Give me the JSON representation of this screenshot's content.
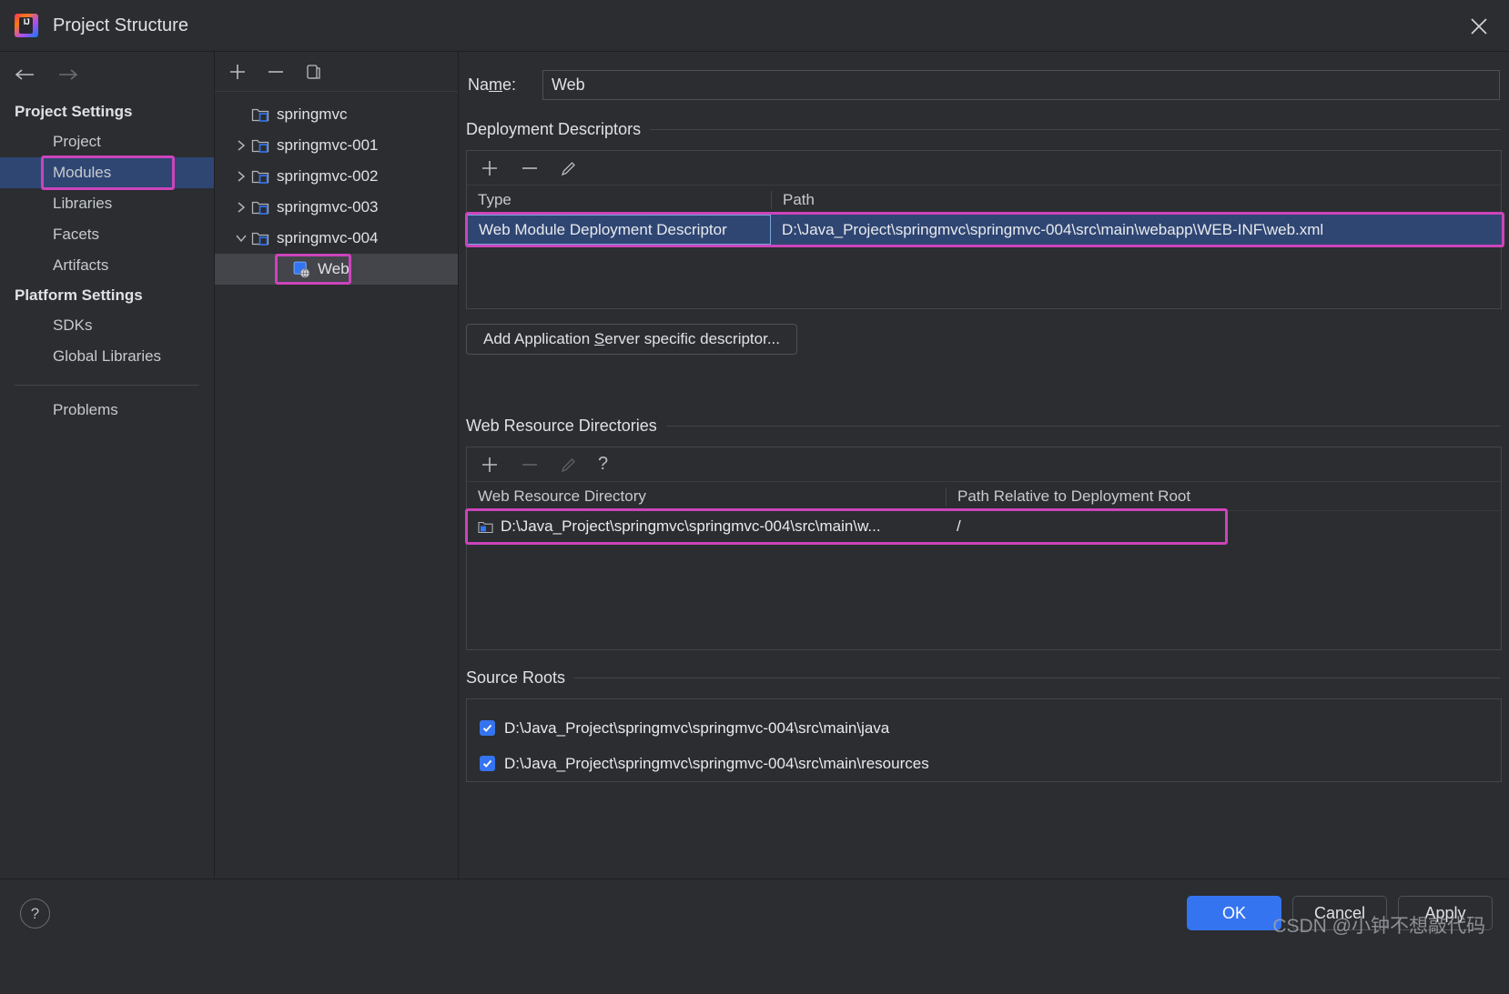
{
  "window": {
    "title": "Project Structure",
    "logo_text": "IJ",
    "close_icon": "close-icon"
  },
  "nav": {
    "back_icon": "arrow-left-icon",
    "forward_icon": "arrow-right-icon"
  },
  "sidebar": {
    "groups": [
      {
        "label": "Project Settings",
        "items": [
          {
            "label": "Project",
            "selected": false
          },
          {
            "label": "Modules",
            "selected": true,
            "annotated": true
          },
          {
            "label": "Libraries",
            "selected": false
          },
          {
            "label": "Facets",
            "selected": false
          },
          {
            "label": "Artifacts",
            "selected": false
          }
        ]
      },
      {
        "label": "Platform Settings",
        "items": [
          {
            "label": "SDKs",
            "selected": false
          },
          {
            "label": "Global Libraries",
            "selected": false
          }
        ]
      }
    ],
    "problems": {
      "label": "Problems"
    }
  },
  "tree": {
    "toolbar": [
      {
        "name": "add-module-button",
        "icon": "plus-icon"
      },
      {
        "name": "remove-module-button",
        "icon": "minus-icon"
      },
      {
        "name": "copy-module-button",
        "icon": "copy-icon"
      }
    ],
    "rows": [
      {
        "label": "springmvc",
        "icon": "module-icon",
        "chevron": "none",
        "indent": 0,
        "selected": false
      },
      {
        "label": "springmvc-001",
        "icon": "module-icon",
        "chevron": "collapsed",
        "indent": 0,
        "selected": false
      },
      {
        "label": "springmvc-002",
        "icon": "module-icon",
        "chevron": "collapsed",
        "indent": 0,
        "selected": false
      },
      {
        "label": "springmvc-003",
        "icon": "module-icon",
        "chevron": "collapsed",
        "indent": 0,
        "selected": false
      },
      {
        "label": "springmvc-004",
        "icon": "module-icon",
        "chevron": "expanded",
        "indent": 0,
        "selected": false
      },
      {
        "label": "Web",
        "icon": "web-facet-icon",
        "chevron": "none",
        "indent": 1,
        "selected": true,
        "annotated": true
      }
    ]
  },
  "main": {
    "name_field": {
      "label_pre": "Na",
      "label_mnemonic": "m",
      "label_post": "e:",
      "value": "Web"
    },
    "deployment_descriptors": {
      "title": "Deployment Descriptors",
      "toolbar": [
        {
          "name": "add-descriptor-button",
          "icon": "plus-icon",
          "enabled": true
        },
        {
          "name": "remove-descriptor-button",
          "icon": "minus-icon",
          "enabled": true
        },
        {
          "name": "edit-descriptor-button",
          "icon": "pencil-icon",
          "enabled": true
        }
      ],
      "columns": [
        "Type",
        "Path"
      ],
      "rows": [
        {
          "type": "Web Module Deployment Descriptor",
          "path": "D:\\Java_Project\\springmvc\\springmvc-004\\src\\main\\webapp\\WEB-INF\\web.xml",
          "selected": true,
          "annotated": true
        }
      ],
      "add_server_descriptor_button": {
        "pre": "Add Application ",
        "mnemonic": "S",
        "post": "erver specific descriptor..."
      }
    },
    "web_resource_directories": {
      "title": "Web Resource Directories",
      "toolbar": [
        {
          "name": "add-web-resource-button",
          "icon": "plus-icon",
          "enabled": true
        },
        {
          "name": "remove-web-resource-button",
          "icon": "minus-icon",
          "enabled": false
        },
        {
          "name": "edit-web-resource-button",
          "icon": "pencil-icon",
          "enabled": false
        },
        {
          "name": "web-resource-help-button",
          "icon": "question-icon",
          "enabled": true
        }
      ],
      "columns": [
        "Web Resource Directory",
        "Path Relative to Deployment Root"
      ],
      "rows": [
        {
          "directory": "D:\\Java_Project\\springmvc\\springmvc-004\\src\\main\\w...",
          "relative_path": "/",
          "icon": "folder-icon",
          "annotated": true
        }
      ]
    },
    "source_roots": {
      "title": "Source Roots",
      "rows": [
        {
          "path": "D:\\Java_Project\\springmvc\\springmvc-004\\src\\main\\java",
          "checked": true
        },
        {
          "path": "D:\\Java_Project\\springmvc\\springmvc-004\\src\\main\\resources",
          "checked": true
        }
      ]
    }
  },
  "footer": {
    "help_label": "?",
    "ok_label": "OK",
    "cancel_label": "Cancel",
    "apply_label": "Apply"
  },
  "watermark": "CSDN @小钟不想敲代码",
  "colors": {
    "accent_blue": "#3574f0",
    "selection_blue": "#2f4673",
    "annotation_magenta": "#cc44bb",
    "panel_bg": "#2b2d30",
    "row_selected_gray": "#43454a"
  }
}
